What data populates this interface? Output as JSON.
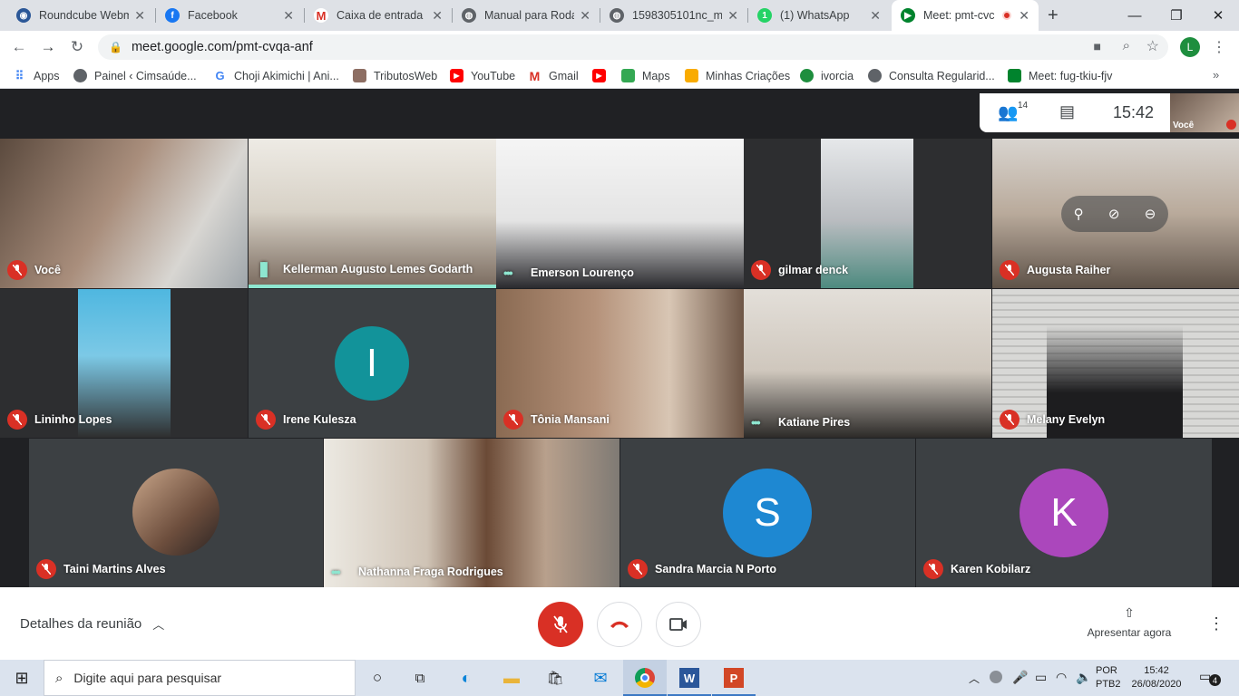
{
  "browser": {
    "tabs": [
      {
        "title": "Roundcube Webm",
        "icon": "roundcube-icon",
        "color": "#2b5797"
      },
      {
        "title": "Facebook",
        "icon": "facebook-icon",
        "color": "#1877f2"
      },
      {
        "title": "Caixa de entrada (",
        "icon": "gmail-icon",
        "color": "#d93025"
      },
      {
        "title": "Manual para Roda",
        "icon": "globe-icon",
        "color": "#5f6368"
      },
      {
        "title": "1598305101nc_ma",
        "icon": "globe-icon",
        "color": "#5f6368"
      },
      {
        "title": "(1) WhatsApp",
        "icon": "whatsapp-icon",
        "color": "#25d366"
      },
      {
        "title": "Meet: pmt-cvc",
        "icon": "meet-icon",
        "color": "#00832d"
      }
    ],
    "url": "meet.google.com/pmt-cvqa-anf",
    "profile_initial": "L",
    "bookmarks": [
      {
        "label": "Apps",
        "icon": "apps-icon"
      },
      {
        "label": "Painel ‹ Cimsaúde...",
        "icon": "globe-icon"
      },
      {
        "label": "Choji Akimichi | Ani...",
        "icon": "google-icon"
      },
      {
        "label": "TributosWeb",
        "icon": "tributosweb-icon"
      },
      {
        "label": "YouTube",
        "icon": "youtube-icon"
      },
      {
        "label": "Gmail",
        "icon": "gmail-icon"
      },
      {
        "label": "",
        "icon": "youtube-icon"
      },
      {
        "label": "Maps",
        "icon": "maps-icon"
      },
      {
        "label": "Minhas Criações",
        "icon": "bookmark-icon"
      },
      {
        "label": "ivorcia",
        "icon": "ivorcia-icon"
      },
      {
        "label": "Consulta Regularid...",
        "icon": "globe-icon"
      },
      {
        "label": "Meet: fug-tkiu-fjv",
        "icon": "meet-icon"
      }
    ]
  },
  "meet": {
    "participant_count": "14",
    "clock": "15:42",
    "self_label": "Você",
    "participants": [
      {
        "name": "Você",
        "status": "muted"
      },
      {
        "name": "Kellerman Augusto Lemes Godarth",
        "status": "speaking"
      },
      {
        "name": "Emerson Lourenço",
        "status": "active"
      },
      {
        "name": "gilmar denck",
        "status": "muted"
      },
      {
        "name": "Augusta Raiher",
        "status": "muted"
      },
      {
        "name": "Lininho Lopes",
        "status": "muted"
      },
      {
        "name": "Irene Kulesza",
        "status": "muted",
        "initial": "I",
        "avatar_color": "#12939a"
      },
      {
        "name": "Tônia Mansani",
        "status": "muted"
      },
      {
        "name": "Katiane Pires",
        "status": "active"
      },
      {
        "name": "Melany Evelyn",
        "status": "muted"
      },
      {
        "name": "Taini Martins Alves",
        "status": "muted"
      },
      {
        "name": "Nathanna Fraga Rodrigues",
        "status": "active"
      },
      {
        "name": "Sandra Marcia N Porto",
        "status": "muted",
        "initial": "S",
        "avatar_color": "#1e88d2"
      },
      {
        "name": "Karen Kobilarz",
        "status": "muted",
        "initial": "K",
        "avatar_color": "#ab47bc"
      }
    ],
    "details_label": "Detalhes da reunião",
    "present_label": "Apresentar agora"
  },
  "taskbar": {
    "search_placeholder": "Digite aqui para pesquisar",
    "lang": "POR",
    "layout": "PTB2",
    "time": "15:42",
    "date": "26/08/2020",
    "notifications": "4"
  }
}
